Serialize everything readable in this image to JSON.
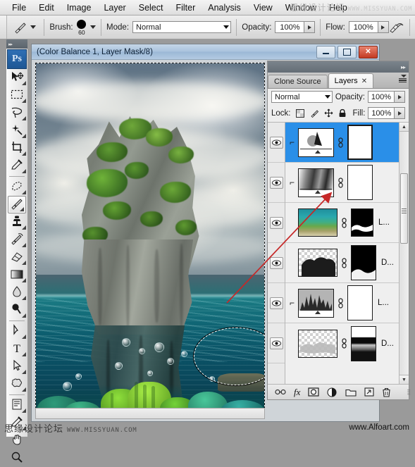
{
  "menubar": {
    "items": [
      "File",
      "Edit",
      "Image",
      "Layer",
      "Select",
      "Filter",
      "Analysis",
      "View",
      "Window",
      "Help"
    ]
  },
  "watermarks": {
    "top_cn": "思缘设计论坛",
    "top_en": "WWW.MISSYUAN.COM",
    "bottom_left_cn": "思缘设计论坛",
    "bottom_left_en": "WWW.MISSYUAN.COM",
    "bottom_right": "www.Alfoart.com"
  },
  "options_bar": {
    "tool_preset_icon": "brush-icon",
    "brush_label": "Brush:",
    "brush_size": "60",
    "mode_label": "Mode:",
    "mode_value": "Normal",
    "opacity_label": "Opacity:",
    "opacity_value": "100%",
    "flow_label": "Flow:",
    "flow_value": "100%",
    "airbrush_icon": "airbrush-icon"
  },
  "toolbox": {
    "logo": "Ps",
    "tools": [
      {
        "name": "move-tool",
        "icon": "move-icon"
      },
      {
        "name": "rectangular-marquee-tool",
        "icon": "marquee-icon"
      },
      {
        "name": "lasso-tool",
        "icon": "lasso-icon"
      },
      {
        "name": "magic-wand-tool",
        "icon": "magic-wand-icon"
      },
      {
        "name": "crop-tool",
        "icon": "crop-icon"
      },
      {
        "name": "eyedropper-tool",
        "icon": "eyedropper-icon"
      },
      {
        "name": "healing-brush-tool",
        "icon": "healing-brush-icon"
      },
      {
        "name": "brush-tool",
        "icon": "brush-icon",
        "active": true
      },
      {
        "name": "clone-stamp-tool",
        "icon": "clone-stamp-icon"
      },
      {
        "name": "history-brush-tool",
        "icon": "history-brush-icon"
      },
      {
        "name": "eraser-tool",
        "icon": "eraser-icon"
      },
      {
        "name": "gradient-tool",
        "icon": "gradient-icon"
      },
      {
        "name": "blur-tool",
        "icon": "blur-icon"
      },
      {
        "name": "dodge-tool",
        "icon": "dodge-icon"
      },
      {
        "name": "pen-tool",
        "icon": "pen-icon"
      },
      {
        "name": "type-tool",
        "icon": "type-icon"
      },
      {
        "name": "path-selection-tool",
        "icon": "path-arrow-icon"
      },
      {
        "name": "shape-tool",
        "icon": "custom-shape-icon"
      },
      {
        "name": "notes-tool",
        "icon": "notes-icon"
      },
      {
        "name": "color-sampler-tool",
        "icon": "eyedropper-icon"
      },
      {
        "name": "hand-tool",
        "icon": "hand-icon"
      },
      {
        "name": "zoom-tool",
        "icon": "magnifier-icon"
      }
    ]
  },
  "document": {
    "title": "(Color Balance 1, Layer Mask/8)",
    "window_buttons": [
      "minimize",
      "restore",
      "close"
    ],
    "close_glyph": "✕",
    "status": ""
  },
  "layers_panel": {
    "tabs": [
      {
        "label": "Clone Source",
        "active": false,
        "closable": false
      },
      {
        "label": "Layers",
        "active": true,
        "closable": true,
        "close_glyph": "✕"
      }
    ],
    "blend_mode": "Normal",
    "opacity_label": "Opacity:",
    "opacity_value": "100%",
    "lock_label": "Lock:",
    "lock_icons": [
      "lock-transparent-icon",
      "lock-image-icon",
      "lock-position-icon",
      "lock-all-icon"
    ],
    "fill_label": "Fill:",
    "fill_value": "100%",
    "rows": [
      {
        "name_text": "",
        "kind": "adjustment",
        "adj_type": "color-balance",
        "visible": true,
        "clipped": true,
        "selected": true,
        "has_mask": true,
        "mask_kind": "white"
      },
      {
        "name_text": "",
        "kind": "adjustment",
        "adj_type": "gradient-map",
        "visible": true,
        "clipped": true,
        "selected": false,
        "has_mask": true,
        "mask_kind": "white"
      },
      {
        "name_text": "L...",
        "kind": "image",
        "adj_type": "coral-reef-photo",
        "visible": true,
        "clipped": false,
        "selected": false,
        "has_mask": true,
        "mask_kind": "black-wave"
      },
      {
        "name_text": "D...",
        "kind": "image",
        "adj_type": "dark-rock-transparent",
        "visible": true,
        "clipped": false,
        "selected": false,
        "has_mask": true,
        "mask_kind": "black-bottom-white"
      },
      {
        "name_text": "L...",
        "kind": "adjustment",
        "adj_type": "levels",
        "visible": true,
        "clipped": true,
        "selected": false,
        "has_mask": true,
        "mask_kind": "white"
      },
      {
        "name_text": "D...",
        "kind": "image",
        "adj_type": "light-rock-transparent",
        "visible": true,
        "clipped": false,
        "selected": false,
        "has_mask": true,
        "mask_kind": "gradient-bands"
      }
    ],
    "bottom_buttons": [
      {
        "name": "link-layers-button",
        "icon": "link-icon"
      },
      {
        "name": "layer-style-button",
        "icon": "fx-icon",
        "label": "fx"
      },
      {
        "name": "add-layer-mask-button",
        "icon": "mask-icon"
      },
      {
        "name": "new-adjustment-layer-button",
        "icon": "half-circle-icon"
      },
      {
        "name": "new-group-button",
        "icon": "folder-icon"
      },
      {
        "name": "new-layer-button",
        "icon": "new-layer-icon"
      },
      {
        "name": "delete-layer-button",
        "icon": "trash-icon"
      }
    ],
    "scrollbar": {
      "up_glyph": "▲",
      "down_glyph": "▼"
    }
  },
  "canvas": {
    "description": "floating rock island above and below teal ocean water with coral reef",
    "selection": "elliptical-marquee",
    "annotation": "red-arrow"
  },
  "colors": {
    "accent_selected_layer": "#2a8fe8",
    "close_button": "#c33a23",
    "panel_bg": "#efefef",
    "water": "#0d5f70",
    "coral_green": "#7fd43a"
  }
}
